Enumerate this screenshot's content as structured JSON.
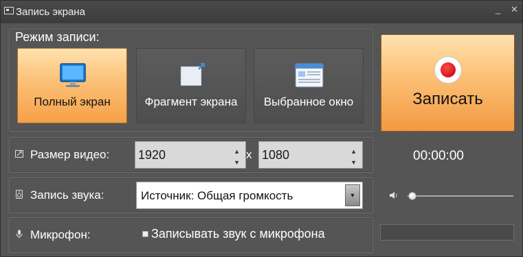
{
  "window": {
    "title": "Запись экрана",
    "minimize_glyph": "_",
    "close_glyph": "✕"
  },
  "mode": {
    "title": "Режим записи:",
    "buttons": [
      {
        "label": "Полный экран",
        "icon": "monitor-icon",
        "active": true
      },
      {
        "label": "Фрагмент экрана",
        "icon": "fragment-select-icon",
        "active": false
      },
      {
        "label": "Выбранное окно",
        "icon": "window-icon",
        "active": false
      }
    ]
  },
  "record": {
    "label": "Записать",
    "icon": "record-icon"
  },
  "size": {
    "label": "Размер видео:",
    "width": "1920",
    "height": "1080",
    "separator": "x",
    "spin_up": "▲",
    "spin_down": "▼"
  },
  "timer": "00:00:00",
  "audio": {
    "label": "Запись звука:",
    "source": "Источник: Общая громкость",
    "dropdown_glyph": "▼"
  },
  "volume": {
    "icon": "speaker-icon",
    "level": 0.02
  },
  "mic": {
    "label": "Микрофон:",
    "checkbox_label": "Записывать звук с микрофона",
    "checked": false
  },
  "colors": {
    "accent_orange": "#fcc37a",
    "record_red": "#d40000",
    "panel_bg": "#555555"
  }
}
